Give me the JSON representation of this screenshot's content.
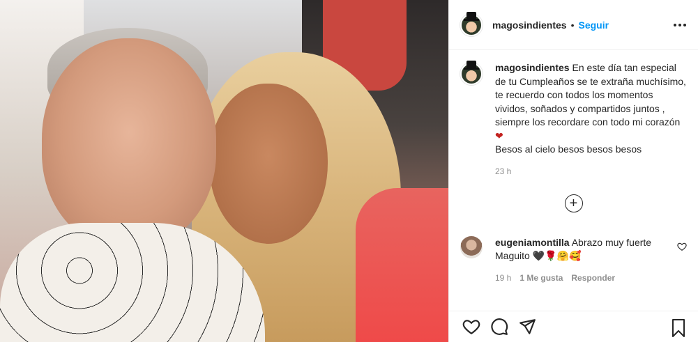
{
  "post": {
    "username": "magosindientes",
    "follow_label": "Seguir",
    "dot": "•"
  },
  "caption": {
    "username": "magosindientes",
    "text": "En este día tan especial de tu Cumpleaños se te extraña muchísimo, te recuerdo con todos los momentos vividos, soñados y compartidos juntos , siempre los recordare con todo mi corazón",
    "heart": "❤",
    "line2": "Besos al cielo besos besos besos",
    "time": "23 h"
  },
  "comments": [
    {
      "username": "eugeniamontilla",
      "text": "Abrazo muy fuerte Maguito",
      "emojis": "🖤🌹🤗🥰",
      "time": "19 h",
      "likes": "1 Me gusta",
      "reply": "Responder"
    }
  ],
  "icons": {
    "more": "more-options-icon",
    "load_more": "plus-circle-icon",
    "like": "heart-icon",
    "comment": "comment-icon",
    "share": "send-icon",
    "save": "bookmark-icon"
  },
  "colors": {
    "accent": "#0095f6",
    "text": "#262626",
    "muted": "#8e8e8e",
    "heart": "#c3221f"
  }
}
